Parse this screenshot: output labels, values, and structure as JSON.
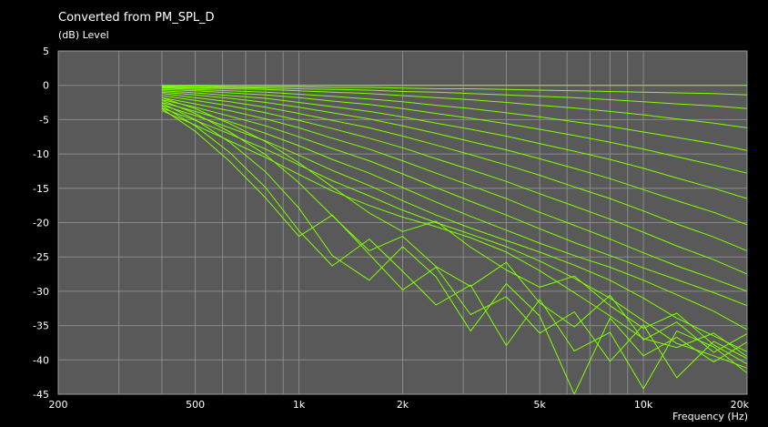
{
  "chart_data": {
    "type": "line",
    "title": "Converted from PM_SPL_D",
    "ylabel": "(dB)  Level",
    "xlabel": "Frequency  (Hz)",
    "x_scale": "log",
    "xlim": [
      200,
      20000
    ],
    "ylim": [
      -45,
      5
    ],
    "x_ticks": [
      {
        "value": 200,
        "label": "200"
      },
      {
        "value": 500,
        "label": "500"
      },
      {
        "value": 1000,
        "label": "1k"
      },
      {
        "value": 2000,
        "label": "2k"
      },
      {
        "value": 5000,
        "label": "5k"
      },
      {
        "value": 10000,
        "label": "10k"
      },
      {
        "value": 20000,
        "label": "20k"
      }
    ],
    "y_ticks": [
      5,
      0,
      -5,
      -10,
      -15,
      -20,
      -25,
      -30,
      -35,
      -40,
      -45
    ],
    "grid": true,
    "colors": {
      "background": "#000000",
      "plot_area": "#595959",
      "grid": "#9a9a9a",
      "series": "#80ff00",
      "text": "#ffffff"
    },
    "x": [
      400,
      500,
      630,
      800,
      1000,
      1250,
      1600,
      2000,
      2500,
      3150,
      4000,
      5000,
      6300,
      8000,
      10000,
      12500,
      16000,
      20000
    ],
    "series": [
      {
        "values": [
          0.0,
          0.0,
          0.0,
          0.0,
          0.0,
          0.0,
          0.0,
          0.0,
          0.0,
          0.0,
          0.0,
          0.0,
          0.0,
          0.0,
          0.0,
          0.0,
          0.0,
          0.0
        ]
      },
      {
        "values": [
          -0.1,
          -0.1,
          -0.2,
          -0.2,
          -0.2,
          -0.3,
          -0.3,
          -0.4,
          -0.5,
          -0.5,
          -0.6,
          -0.7,
          -0.8,
          -0.9,
          -1.0,
          -1.1,
          -1.2,
          -1.4
        ]
      },
      {
        "values": [
          -0.2,
          -0.3,
          -0.3,
          -0.4,
          -0.5,
          -0.6,
          -0.7,
          -0.9,
          -1.0,
          -1.2,
          -1.4,
          -1.6,
          -1.8,
          -2.1,
          -2.4,
          -2.7,
          -3.0,
          -3.4
        ]
      },
      {
        "values": [
          -0.3,
          -0.4,
          -0.5,
          -0.6,
          -0.8,
          -1.0,
          -1.2,
          -1.5,
          -1.8,
          -2.1,
          -2.5,
          -2.9,
          -3.3,
          -3.8,
          -4.3,
          -4.9,
          -5.5,
          -6.2
        ]
      },
      {
        "values": [
          -0.4,
          -0.6,
          -0.8,
          -1.0,
          -1.3,
          -1.6,
          -2.0,
          -2.4,
          -2.9,
          -3.4,
          -4.0,
          -4.6,
          -5.3,
          -6.0,
          -6.8,
          -7.6,
          -8.5,
          -9.5
        ]
      },
      {
        "values": [
          -0.6,
          -0.8,
          -1.1,
          -1.4,
          -1.8,
          -2.3,
          -2.8,
          -3.4,
          -4.1,
          -4.8,
          -5.6,
          -6.4,
          -7.3,
          -8.3,
          -9.3,
          -10.4,
          -11.6,
          -12.8
        ]
      },
      {
        "values": [
          -0.8,
          -1.1,
          -1.5,
          -1.9,
          -2.5,
          -3.1,
          -3.8,
          -4.6,
          -5.5,
          -6.4,
          -7.4,
          -8.5,
          -9.6,
          -10.8,
          -12.1,
          -13.5,
          -15.0,
          -16.5
        ]
      },
      {
        "values": [
          -1.0,
          -1.4,
          -1.9,
          -2.5,
          -3.2,
          -4.0,
          -4.9,
          -5.9,
          -7.0,
          -8.2,
          -9.4,
          -10.7,
          -12.1,
          -13.6,
          -15.2,
          -16.8,
          -18.5,
          -20.3
        ]
      },
      {
        "values": [
          -1.2,
          -1.8,
          -2.4,
          -3.2,
          -4.1,
          -5.1,
          -6.2,
          -7.4,
          -8.7,
          -10.1,
          -11.6,
          -13.1,
          -14.8,
          -16.5,
          -18.3,
          -20.2,
          -22.1,
          -24.1
        ]
      },
      {
        "values": [
          -1.5,
          -2.2,
          -3.0,
          -4.0,
          -5.1,
          -6.3,
          -7.7,
          -9.1,
          -10.7,
          -12.3,
          -14.0,
          -15.8,
          -17.6,
          -19.5,
          -21.4,
          -23.4,
          -25.4,
          -27.5
        ]
      },
      {
        "values": [
          -1.8,
          -2.7,
          -3.7,
          -4.9,
          -6.2,
          -7.7,
          -9.3,
          -11.0,
          -12.8,
          -14.6,
          -16.5,
          -18.5,
          -20.4,
          -22.4,
          -24.4,
          -26.3,
          -28.2,
          -30.0
        ]
      },
      {
        "values": [
          -2.1,
          -3.2,
          -4.5,
          -5.9,
          -7.5,
          -9.2,
          -11.0,
          -12.9,
          -14.9,
          -16.9,
          -18.9,
          -20.9,
          -22.9,
          -24.8,
          -26.6,
          -28.3,
          -30.2,
          -32.1
        ]
      },
      {
        "values": [
          -2.5,
          -3.8,
          -5.3,
          -7.0,
          -8.8,
          -10.8,
          -12.8,
          -14.9,
          -17.0,
          -19.1,
          -21.1,
          -23.0,
          -24.8,
          -26.5,
          -28.4,
          -30.5,
          -32.9,
          -35.6
        ]
      },
      {
        "values": [
          -2.9,
          -4.4,
          -6.2,
          -8.1,
          -10.2,
          -12.4,
          -14.6,
          -16.8,
          -18.9,
          -20.8,
          -22.6,
          -24.3,
          -26.2,
          -28.4,
          -31.0,
          -33.9,
          -36.5,
          -38.8
        ]
      },
      {
        "values": [
          -3.3,
          -5.1,
          -7.1,
          -9.3,
          -11.6,
          -13.9,
          -16.1,
          -18.2,
          -20.0,
          -21.7,
          -23.5,
          -25.6,
          -28.1,
          -31.0,
          -34.3,
          -37.6,
          -39.4,
          -41.2
        ]
      },
      {
        "values": [
          -3.7,
          -5.8,
          -8.1,
          -10.5,
          -13.0,
          -15.4,
          -17.5,
          -19.2,
          -20.6,
          -22.2,
          -24.3,
          -27.0,
          -30.2,
          -33.6,
          -36.9,
          -38.2,
          -36.1,
          -39.5
        ]
      },
      {
        "values": [
          -1.8,
          -3.4,
          -5.6,
          -8.2,
          -11.3,
          -14.8,
          -18.6,
          -21.3,
          -19.8,
          -23.6,
          -26.9,
          -29.4,
          -27.8,
          -32.1,
          -35.4,
          -33.2,
          -37.8,
          -40.6
        ]
      },
      {
        "values": [
          -2.2,
          -4.1,
          -6.8,
          -10.1,
          -14.2,
          -19.0,
          -24.1,
          -22.0,
          -26.4,
          -29.3,
          -25.8,
          -31.7,
          -35.2,
          -30.6,
          -37.1,
          -34.5,
          -38.9,
          -36.2
        ]
      },
      {
        "values": [
          -2.6,
          -5.0,
          -8.3,
          -12.6,
          -17.9,
          -24.8,
          -28.4,
          -23.5,
          -27.9,
          -35.8,
          -28.9,
          -33.6,
          -45.0,
          -33.9,
          -39.4,
          -36.7,
          -40.3,
          -37.4
        ]
      },
      {
        "values": [
          -3.0,
          -5.9,
          -9.8,
          -14.9,
          -21.2,
          -26.3,
          -22.4,
          -27.1,
          -32.0,
          -29.1,
          -37.9,
          -31.2,
          -38.7,
          -36.0,
          -44.2,
          -35.8,
          -38.1,
          -41.9
        ]
      },
      {
        "values": [
          -3.4,
          -6.7,
          -11.1,
          -16.4,
          -22.0,
          -18.9,
          -24.6,
          -29.8,
          -26.5,
          -33.4,
          -30.8,
          -36.1,
          -33.0,
          -40.2,
          -34.9,
          -42.6,
          -37.3,
          -39.8
        ]
      }
    ]
  }
}
